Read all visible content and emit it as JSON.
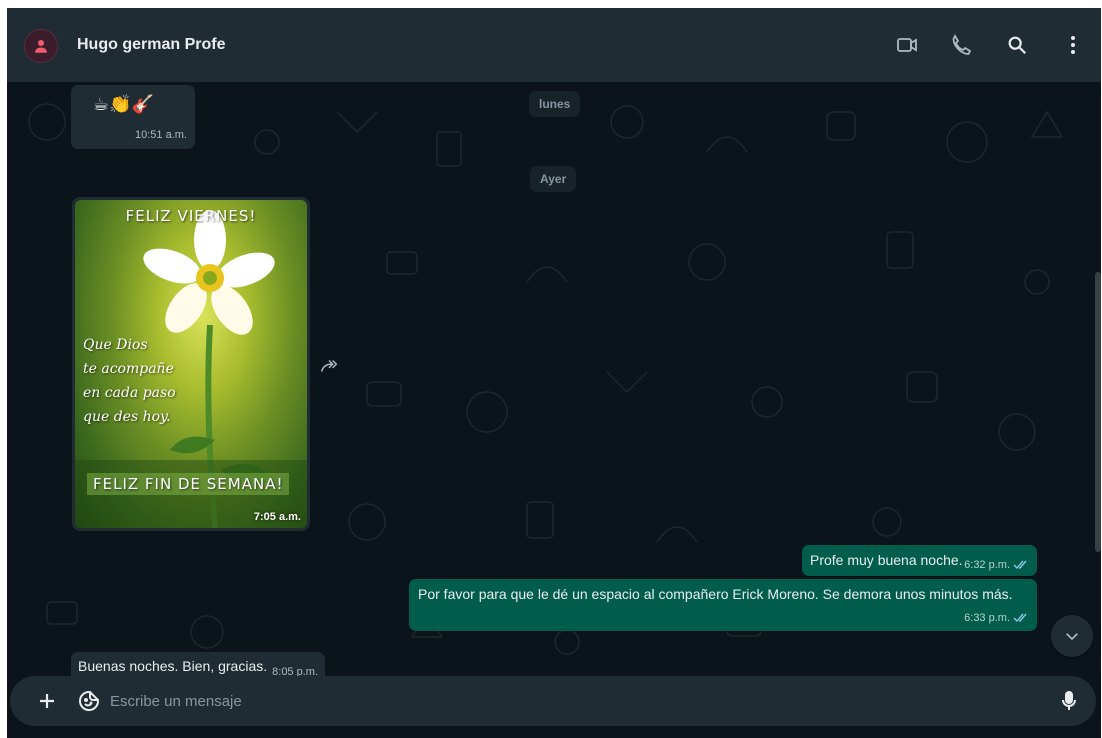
{
  "header": {
    "contact_name": "Hugo german Profe",
    "icons": [
      "avatar-icon",
      "video-call-icon",
      "voice-call-icon",
      "search-icon",
      "menu-icon"
    ]
  },
  "chat": {
    "day_labels": [
      "lunes",
      "Ayer"
    ],
    "messages": [
      {
        "direction": "in",
        "content": "☕👏🎸",
        "time": "10:51 a.m."
      },
      {
        "direction": "in",
        "type": "image",
        "time": "7:05 a.m.",
        "image_text": {
          "top": "FELIZ VIERNES!",
          "quote_lines": [
            "Que Dios",
            "te acompañe",
            "en cada paso",
            "que des hoy."
          ],
          "bottom": "FELIZ FIN DE SEMANA!"
        }
      },
      {
        "direction": "out",
        "text": "Profe muy buena noche.",
        "time": "6:32 p.m."
      },
      {
        "direction": "out",
        "text": "Por favor para que le dé un espacio al compañero Erick Moreno. Se demora unos minutos más.",
        "time": "6:33 p.m."
      },
      {
        "direction": "in",
        "text": "Buenas noches. Bien, gracias.",
        "time": "8:05 p.m."
      }
    ]
  },
  "composer": {
    "placeholder": "Escribe un mensaje"
  },
  "colors": {
    "background": "#0b141a",
    "panel": "#202c33",
    "outgoing_bubble": "#005c4b",
    "text": "#e9edef",
    "muted": "#8696a0"
  }
}
